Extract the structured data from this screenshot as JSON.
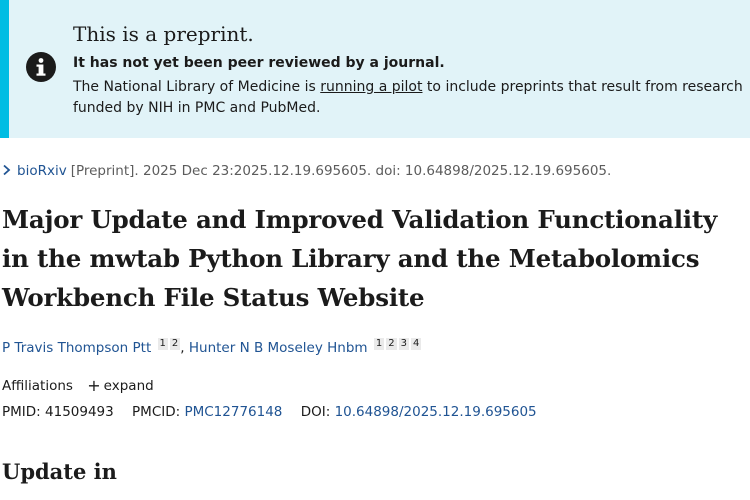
{
  "banner": {
    "heading": "This is a preprint.",
    "bold_line": "It has not yet been peer reviewed by a journal.",
    "body_before_link": "The National Library of Medicine is ",
    "link_text": "running a pilot",
    "body_after_link": " to include preprints that result from research funded by NIH in PMC and PubMed.",
    "icon": "info-icon",
    "accent_color": "#00bde3",
    "background_color": "#e1f3f8"
  },
  "citation": {
    "icon": "chevron-right-icon",
    "journal": "bioRxiv",
    "text": "[Preprint]. 2025 Dec 23:2025.12.19.695605. doi: 10.64898/2025.12.19.695605."
  },
  "article": {
    "title": "Major Update and Improved Validation Functionality in the mwtab Python Library and the Metabolomics Workbench File Status Website",
    "authors": [
      {
        "name": "P Travis Thompson Ptt",
        "affiliations": [
          "1",
          "2"
        ]
      },
      {
        "name": "Hunter N B Moseley Hnbm",
        "affiliations": [
          "1",
          "2",
          "3",
          "4"
        ]
      }
    ],
    "author_separator": ",",
    "affiliations_label": "Affiliations",
    "expand_label": "expand",
    "pmid_label": "PMID:",
    "pmid": "41509493",
    "pmcid_label": "PMCID:",
    "pmcid": "PMC12776148",
    "doi_label": "DOI:",
    "doi": "10.64898/2025.12.19.695605"
  },
  "section": {
    "update_in": "Update in"
  },
  "colors": {
    "link": "#205493",
    "text": "#1b1b1b",
    "muted": "#5c5c5c"
  }
}
